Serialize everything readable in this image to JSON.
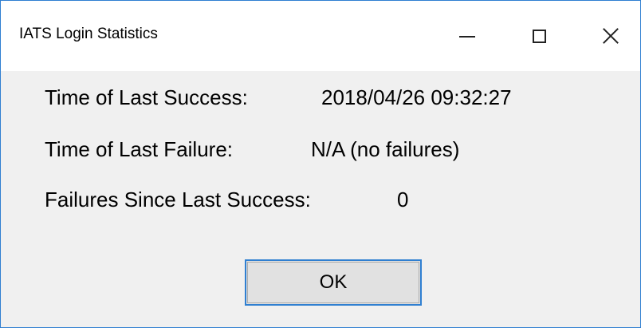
{
  "window": {
    "title": "IATS Login Statistics",
    "accent_color": "#2f7fd1",
    "caption_buttons": {
      "minimize_icon": "minimize-icon",
      "maximize_icon": "maximize-icon",
      "close_icon": "close-icon"
    }
  },
  "stats": {
    "last_success": {
      "label": "Time of Last Success:",
      "value": "2018/04/26 09:32:27"
    },
    "last_failure": {
      "label": "Time of Last Failure:",
      "value": "N/A (no failures)"
    },
    "failures_since": {
      "label": "Failures Since Last Success:",
      "value": "0"
    }
  },
  "actions": {
    "ok_label": "OK"
  }
}
